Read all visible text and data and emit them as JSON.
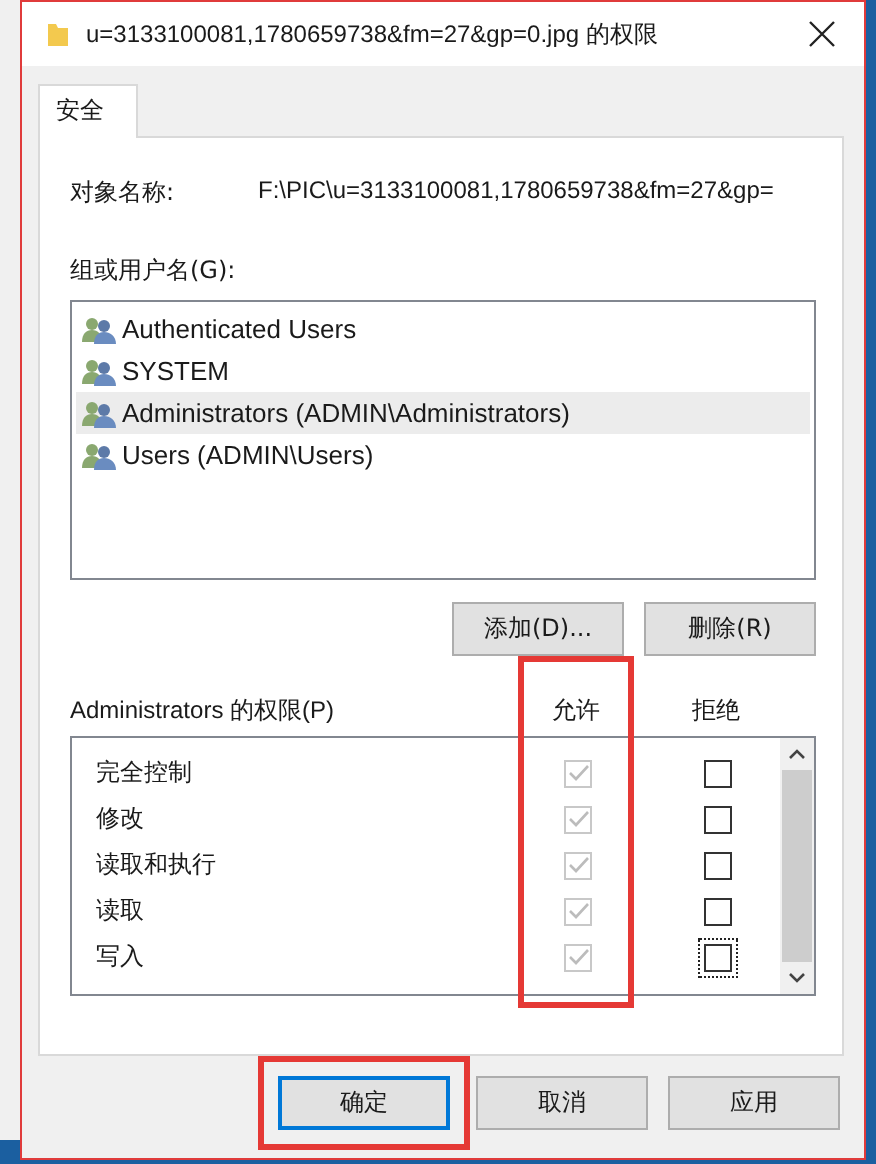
{
  "window": {
    "title": "u=3133100081,1780659738&fm=27&gp=0.jpg 的权限"
  },
  "tabs": [
    {
      "label": "安全",
      "selected": true
    }
  ],
  "object_name": {
    "label": "对象名称:",
    "value": "F:\\PIC\\u=3133100081,1780659738&fm=27&gp="
  },
  "groups": {
    "label": "组或用户名(G):",
    "items": [
      {
        "name": "Authenticated Users",
        "selected": false
      },
      {
        "name": "SYSTEM",
        "selected": false
      },
      {
        "name": "Administrators (ADMIN\\Administrators)",
        "selected": true
      },
      {
        "name": "Users (ADMIN\\Users)",
        "selected": false
      }
    ]
  },
  "group_buttons": [
    "添加(D)...",
    "删除(R)"
  ],
  "permissions": {
    "label": "Administrators 的权限(P)",
    "allow_header": "允许",
    "deny_header": "拒绝",
    "allow_highlighted": true,
    "rows": [
      {
        "name": "完全控制",
        "allow": true,
        "allow_disabled": true,
        "deny": false,
        "focused": false
      },
      {
        "name": "修改",
        "allow": true,
        "allow_disabled": true,
        "deny": false,
        "focused": false
      },
      {
        "name": "读取和执行",
        "allow": true,
        "allow_disabled": true,
        "deny": false,
        "focused": false
      },
      {
        "name": "读取",
        "allow": true,
        "allow_disabled": true,
        "deny": false,
        "focused": false
      },
      {
        "name": "写入",
        "allow": true,
        "allow_disabled": true,
        "deny": false,
        "focused": true
      }
    ]
  },
  "buttons": [
    {
      "label": "确定",
      "default": true,
      "highlighted": true
    },
    {
      "label": "取消",
      "default": false,
      "highlighted": false
    },
    {
      "label": "应用",
      "default": false,
      "highlighted": false
    }
  ]
}
